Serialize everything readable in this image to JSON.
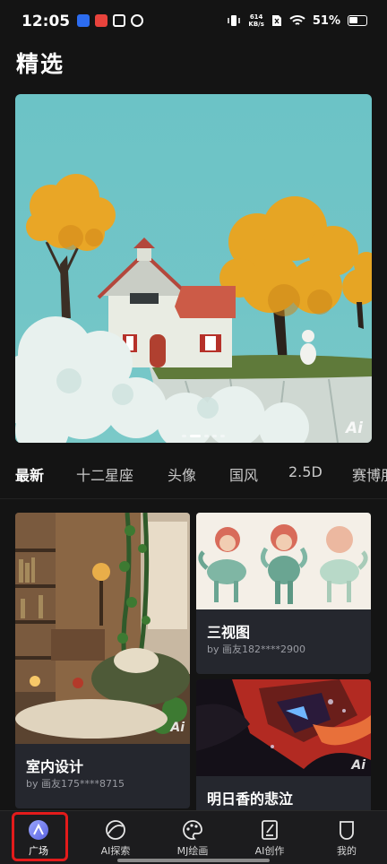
{
  "status_bar": {
    "time": "12:05",
    "net_speed_value": "614",
    "net_speed_unit": "KB/s",
    "battery": "51%"
  },
  "page": {
    "title": "精选"
  },
  "banner": {
    "watermark": "Ai"
  },
  "categories": [
    {
      "label": "最新",
      "active": true
    },
    {
      "label": "十二星座"
    },
    {
      "label": "头像"
    },
    {
      "label": "国风"
    },
    {
      "label": "2.5D"
    },
    {
      "label": "赛博朋"
    }
  ],
  "cards": [
    {
      "title": "室内设计",
      "author": "by 画友175****8715",
      "watermark": "Ai"
    },
    {
      "title": "三视图",
      "author": "by 画友182****2900"
    },
    {
      "title": "明日香的悲泣",
      "watermark": "Ai"
    }
  ],
  "nav": [
    {
      "label": "广场",
      "icon": "plaza-icon",
      "active": true
    },
    {
      "label": "AI探索",
      "icon": "explore-icon"
    },
    {
      "label": "MJ绘画",
      "icon": "palette-icon"
    },
    {
      "label": "AI创作",
      "icon": "create-icon"
    },
    {
      "label": "我的",
      "icon": "profile-icon"
    }
  ],
  "colors": {
    "background": "#141414",
    "card": "#25272e",
    "nav": "#1c1c1e",
    "highlight": "#e31b1b",
    "accent": "#6e7cff"
  }
}
